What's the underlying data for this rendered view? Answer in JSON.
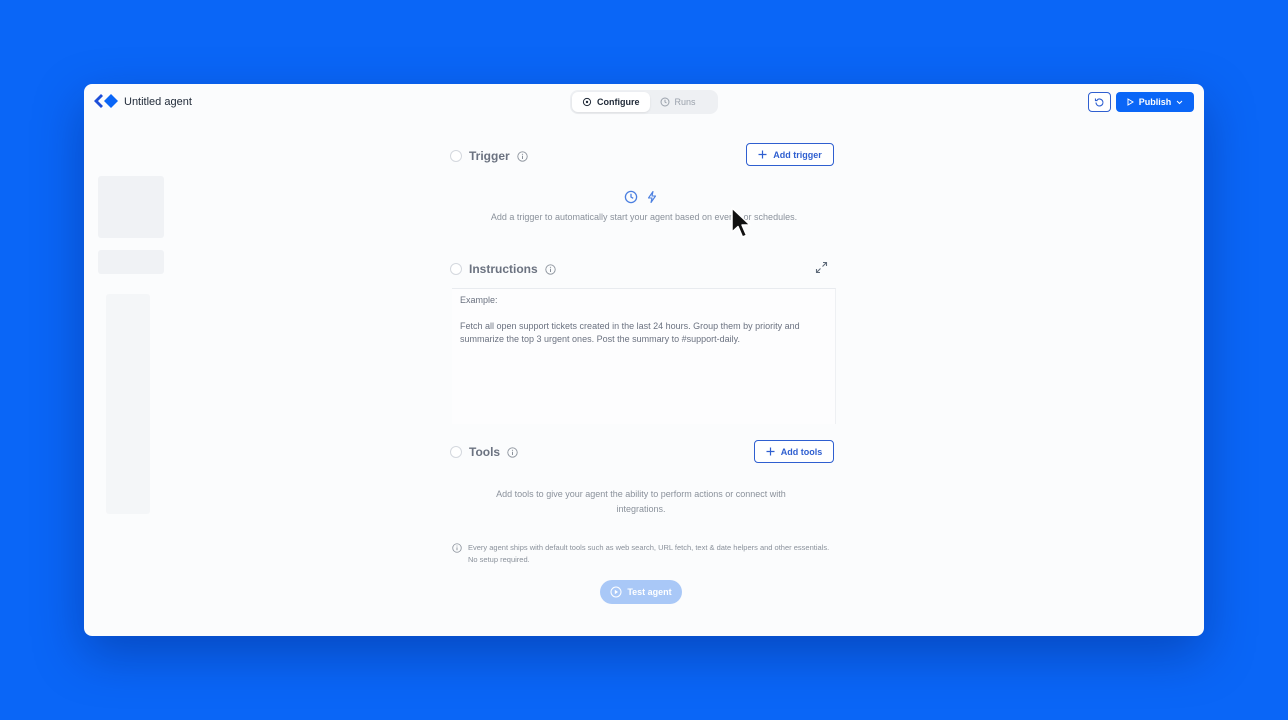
{
  "header": {
    "title": "Untitled agent",
    "tabs": [
      {
        "label": "Configure",
        "active": true
      },
      {
        "label": "Runs",
        "active": false
      }
    ],
    "publish_label": "Publish"
  },
  "trigger": {
    "title": "Trigger",
    "add_label": "Add trigger",
    "empty_text": "Add a trigger to automatically start your agent based on events or schedules."
  },
  "instructions": {
    "title": "Instructions",
    "example_label": "Example:",
    "example_text": "Fetch all open support tickets created in the last 24 hours. Group them by priority and summarize the top 3 urgent ones. Post the summary to #support-daily."
  },
  "tools": {
    "title": "Tools",
    "add_label": "Add tools",
    "empty_text": "Add tools to give your agent the ability to perform actions or connect with integrations.",
    "note": "Every agent ships with default tools such as web search, URL fetch, text & date helpers and other essentials. No setup required."
  },
  "test_label": "Test agent",
  "colors": {
    "background": "#0a66f7",
    "accent": "#2f5fd0",
    "surface": "#fbfcfd"
  },
  "icons": [
    "logo-icon",
    "configure-icon",
    "runs-clock-icon",
    "history-icon",
    "play-icon",
    "chevron-down-icon",
    "info-icon",
    "plus-icon",
    "clock-icon",
    "bolt-icon",
    "expand-icon",
    "play-circle-icon",
    "cursor-icon"
  ]
}
